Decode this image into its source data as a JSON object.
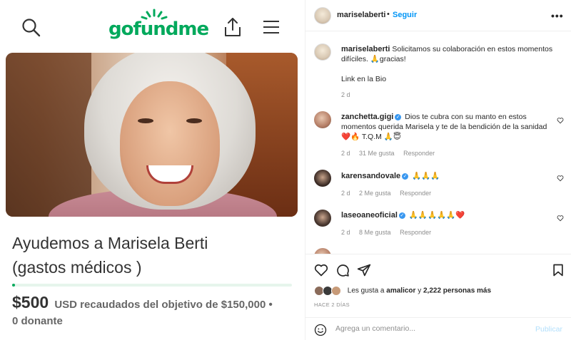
{
  "gofundme": {
    "logo_text": "gofundme",
    "campaign_title_line1": "Ayudemos a Marisela Berti",
    "campaign_title_line2": "(gastos médicos )",
    "progress_fraction": 0.0033,
    "raised_amount": "$500",
    "raised_text": "USD recaudados del objetivo de $150,000 •",
    "donors_text": "0 donante",
    "brand_color": "#02a95c"
  },
  "instagram": {
    "header": {
      "username": "mariselaberti",
      "separator": "•",
      "follow_label": "Seguir",
      "more_label": "•••"
    },
    "caption": {
      "username": "mariselaberti",
      "line1": "Solicitamos su colaboración en estos momentos",
      "line2": "difíciles. 🙏gracias!",
      "line3": "Link en la Bio",
      "time": "2 d"
    },
    "comments": [
      {
        "username": "zanchetta.gigi",
        "verified": true,
        "line1": "Dios te cubra con su manto en estos",
        "line2": "momentos querida Marisela y te de la bendición de la sanidad",
        "line3": "❤️🔥 T.Q.M 🙏😇",
        "time": "2 d",
        "likes": "31 Me gusta",
        "reply": "Responder"
      },
      {
        "username": "karensandovale",
        "verified": true,
        "line1": "🙏🙏🙏",
        "time": "2 d",
        "likes": "2 Me gusta",
        "reply": "Responder"
      },
      {
        "username": "laseoaneoficial",
        "verified": true,
        "line1": "🙏🙏🙏🙏🙏❤️",
        "time": "2 d",
        "likes": "8 Me gusta",
        "reply": "Responder"
      }
    ],
    "likes": {
      "prefix": "Les gusta a",
      "user": "amalicor",
      "middle": "y",
      "count": "2,222 personas más"
    },
    "timestamp": "HACE 2 DÍAS",
    "comment_placeholder": "Agrega un comentario...",
    "publish_label": "Publicar",
    "accent_color": "#0095f6"
  }
}
